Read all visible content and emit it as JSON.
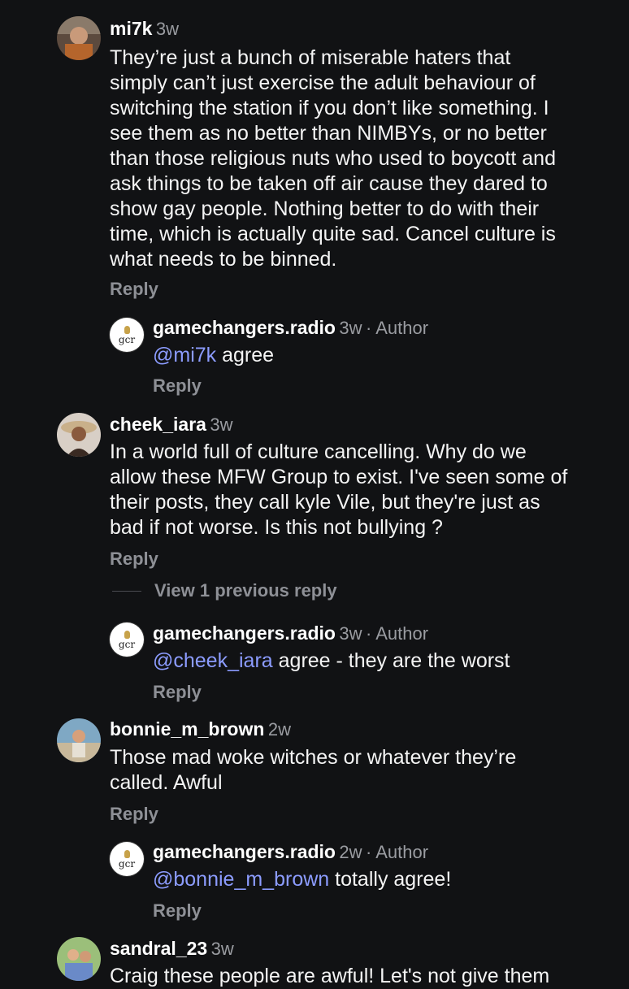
{
  "comments": [
    {
      "username": "mi7k",
      "time": "3w",
      "text_lines": [
        "They’re just a bunch of miserable haters that",
        "simply can’t just exercise the adult behaviour of",
        "switching the station if you don’t like something. I",
        "see them as no better than NIMBYs, or no better",
        "than those religious nuts who used to boycott and",
        "ask things to be taken off air cause they dared to",
        "show gay people. Nothing better to do with their",
        "time, which is actually quite sad. Cancel culture is",
        "what needs to be binned."
      ],
      "reply_label": "Reply",
      "replies": [
        {
          "username": "gamechangers.radio",
          "time": "3w",
          "author_badge": "· Author",
          "mention": "@mi7k",
          "text": " agree",
          "reply_label": "Reply"
        }
      ]
    },
    {
      "username": "cheek_iara",
      "time": "3w",
      "text_lines": [
        "In a world full of culture cancelling. Why do we",
        "allow these MFW Group to exist. I've seen some of",
        "their posts, they call kyle Vile, but they're just as",
        "bad if not worse. Is this not bullying ?"
      ],
      "reply_label": "Reply",
      "view_previous": "View 1 previous reply",
      "replies": [
        {
          "username": "gamechangers.radio",
          "time": "3w",
          "author_badge": "· Author",
          "mention": "@cheek_iara",
          "text": " agree - they are the worst",
          "reply_label": "Reply"
        }
      ]
    },
    {
      "username": "bonnie_m_brown",
      "time": "2w",
      "text_lines": [
        "Those mad woke witches or whatever they’re",
        "called. Awful"
      ],
      "reply_label": "Reply",
      "replies": [
        {
          "username": "gamechangers.radio",
          "time": "2w",
          "author_badge": "· Author",
          "mention": "@bonnie_m_brown",
          "text": " totally agree!",
          "reply_label": "Reply"
        }
      ]
    },
    {
      "username": "sandral_23",
      "time": "3w",
      "text_lines": [
        "Craig these people are awful! Let's not give them"
      ]
    }
  ],
  "logo": {
    "text": "gcr"
  },
  "colors": {
    "background": "#111214",
    "mention": "#8c9cff",
    "muted": "#9a9ca1"
  }
}
